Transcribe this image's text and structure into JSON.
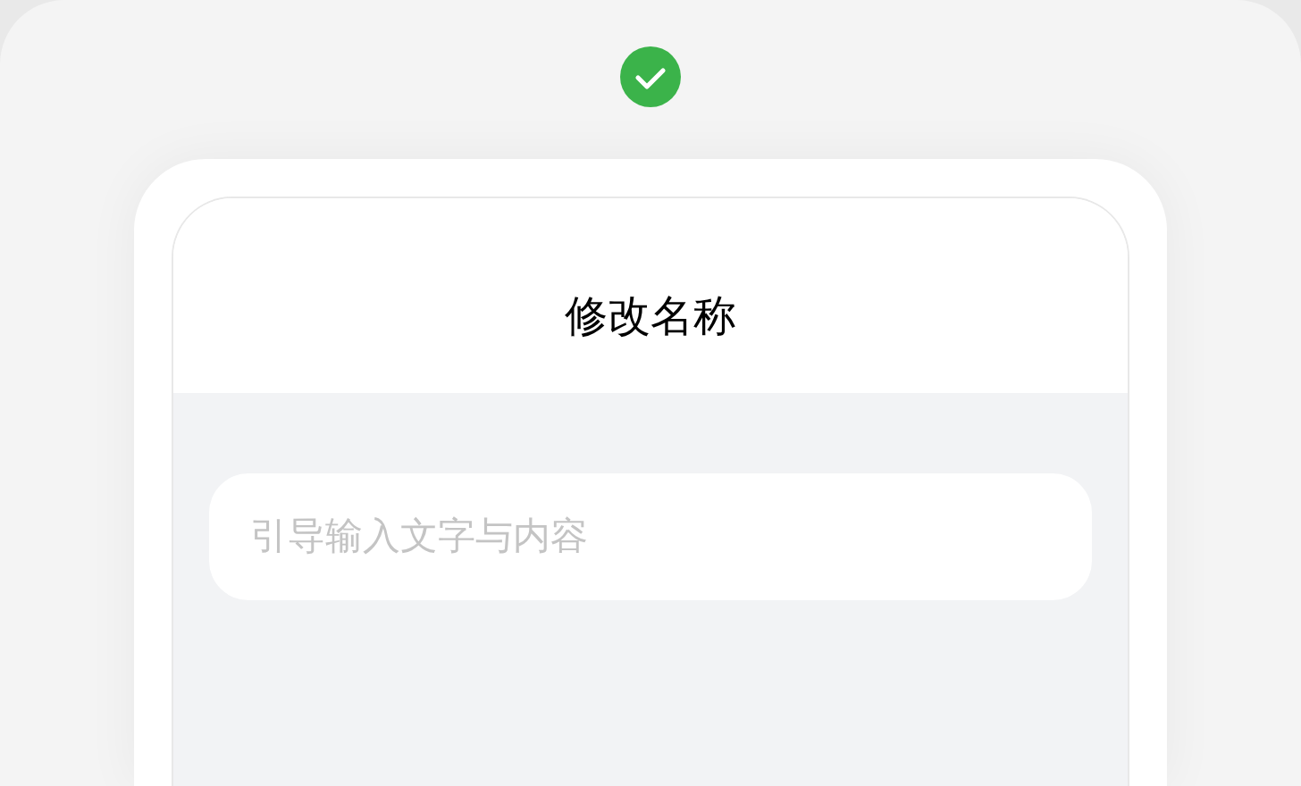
{
  "dialog": {
    "title": "修改名称"
  },
  "name_field": {
    "placeholder": "引导输入文字与内容"
  }
}
